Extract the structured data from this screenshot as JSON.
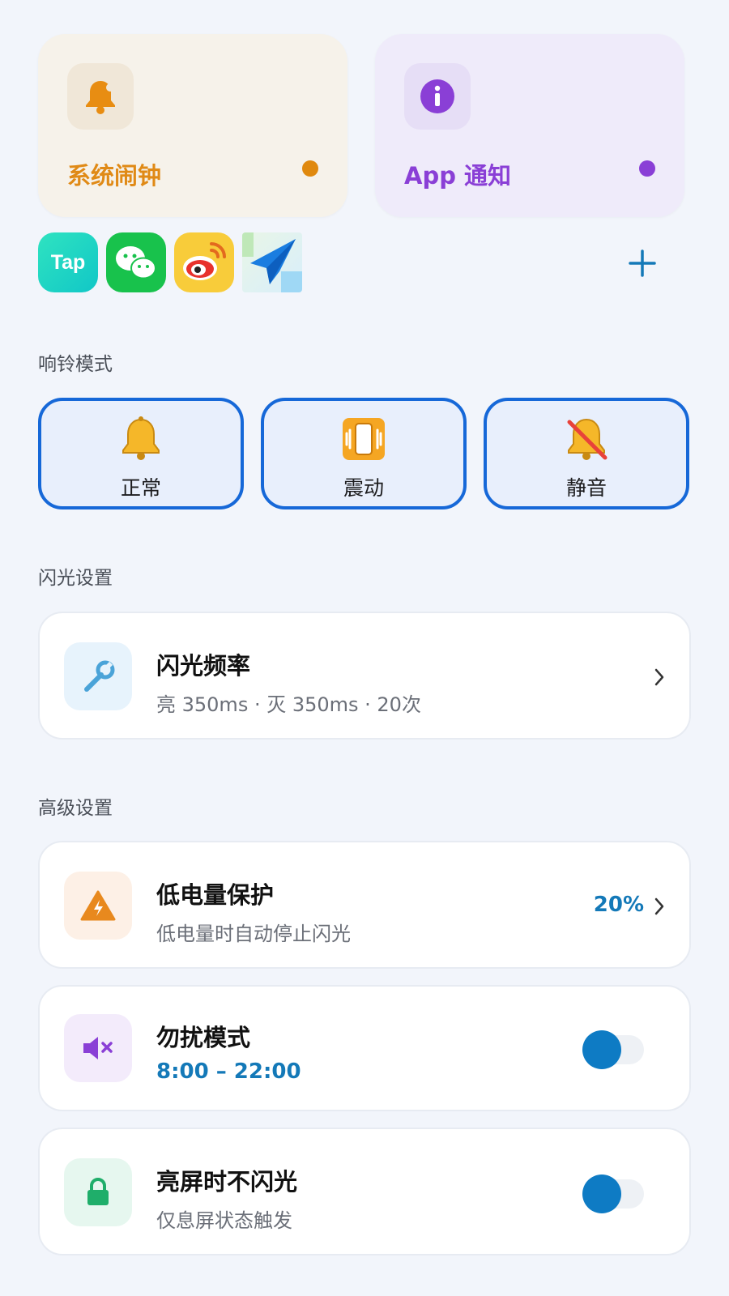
{
  "sources": {
    "alarm": {
      "label": "系统闹钟",
      "icon": "bell-icon",
      "color": "#e08a16"
    },
    "notify": {
      "label": "App 通知",
      "icon": "info-icon",
      "color": "#8a3fd6"
    }
  },
  "apps": {
    "tap_label": "Tap",
    "items": [
      "taptap-app-icon",
      "wechat-app-icon",
      "weibo-app-icon",
      "send-app-icon"
    ],
    "add_icon": "plus-icon"
  },
  "ring": {
    "title": "响铃模式",
    "normal": "正常",
    "vibrate": "震动",
    "silent": "静音"
  },
  "flash": {
    "title": "闪光设置",
    "frequency": {
      "title": "闪光频率",
      "subtitle": "亮 350ms · 灭 350ms · 20次"
    }
  },
  "advanced": {
    "title": "高级设置",
    "battery": {
      "title": "低电量保护",
      "subtitle": "低电量时自动停止闪光",
      "value": "20%"
    },
    "dnd": {
      "title": "勿扰模式",
      "time": "8:00 – 22:00",
      "enabled": true
    },
    "screen": {
      "title": "亮屏时不闪光",
      "subtitle": "仅息屏状态触发",
      "enabled": true
    }
  },
  "colors": {
    "accent": "#1479b8",
    "ring_border": "#1668d8",
    "toggle_on": "#0e7bc4"
  }
}
